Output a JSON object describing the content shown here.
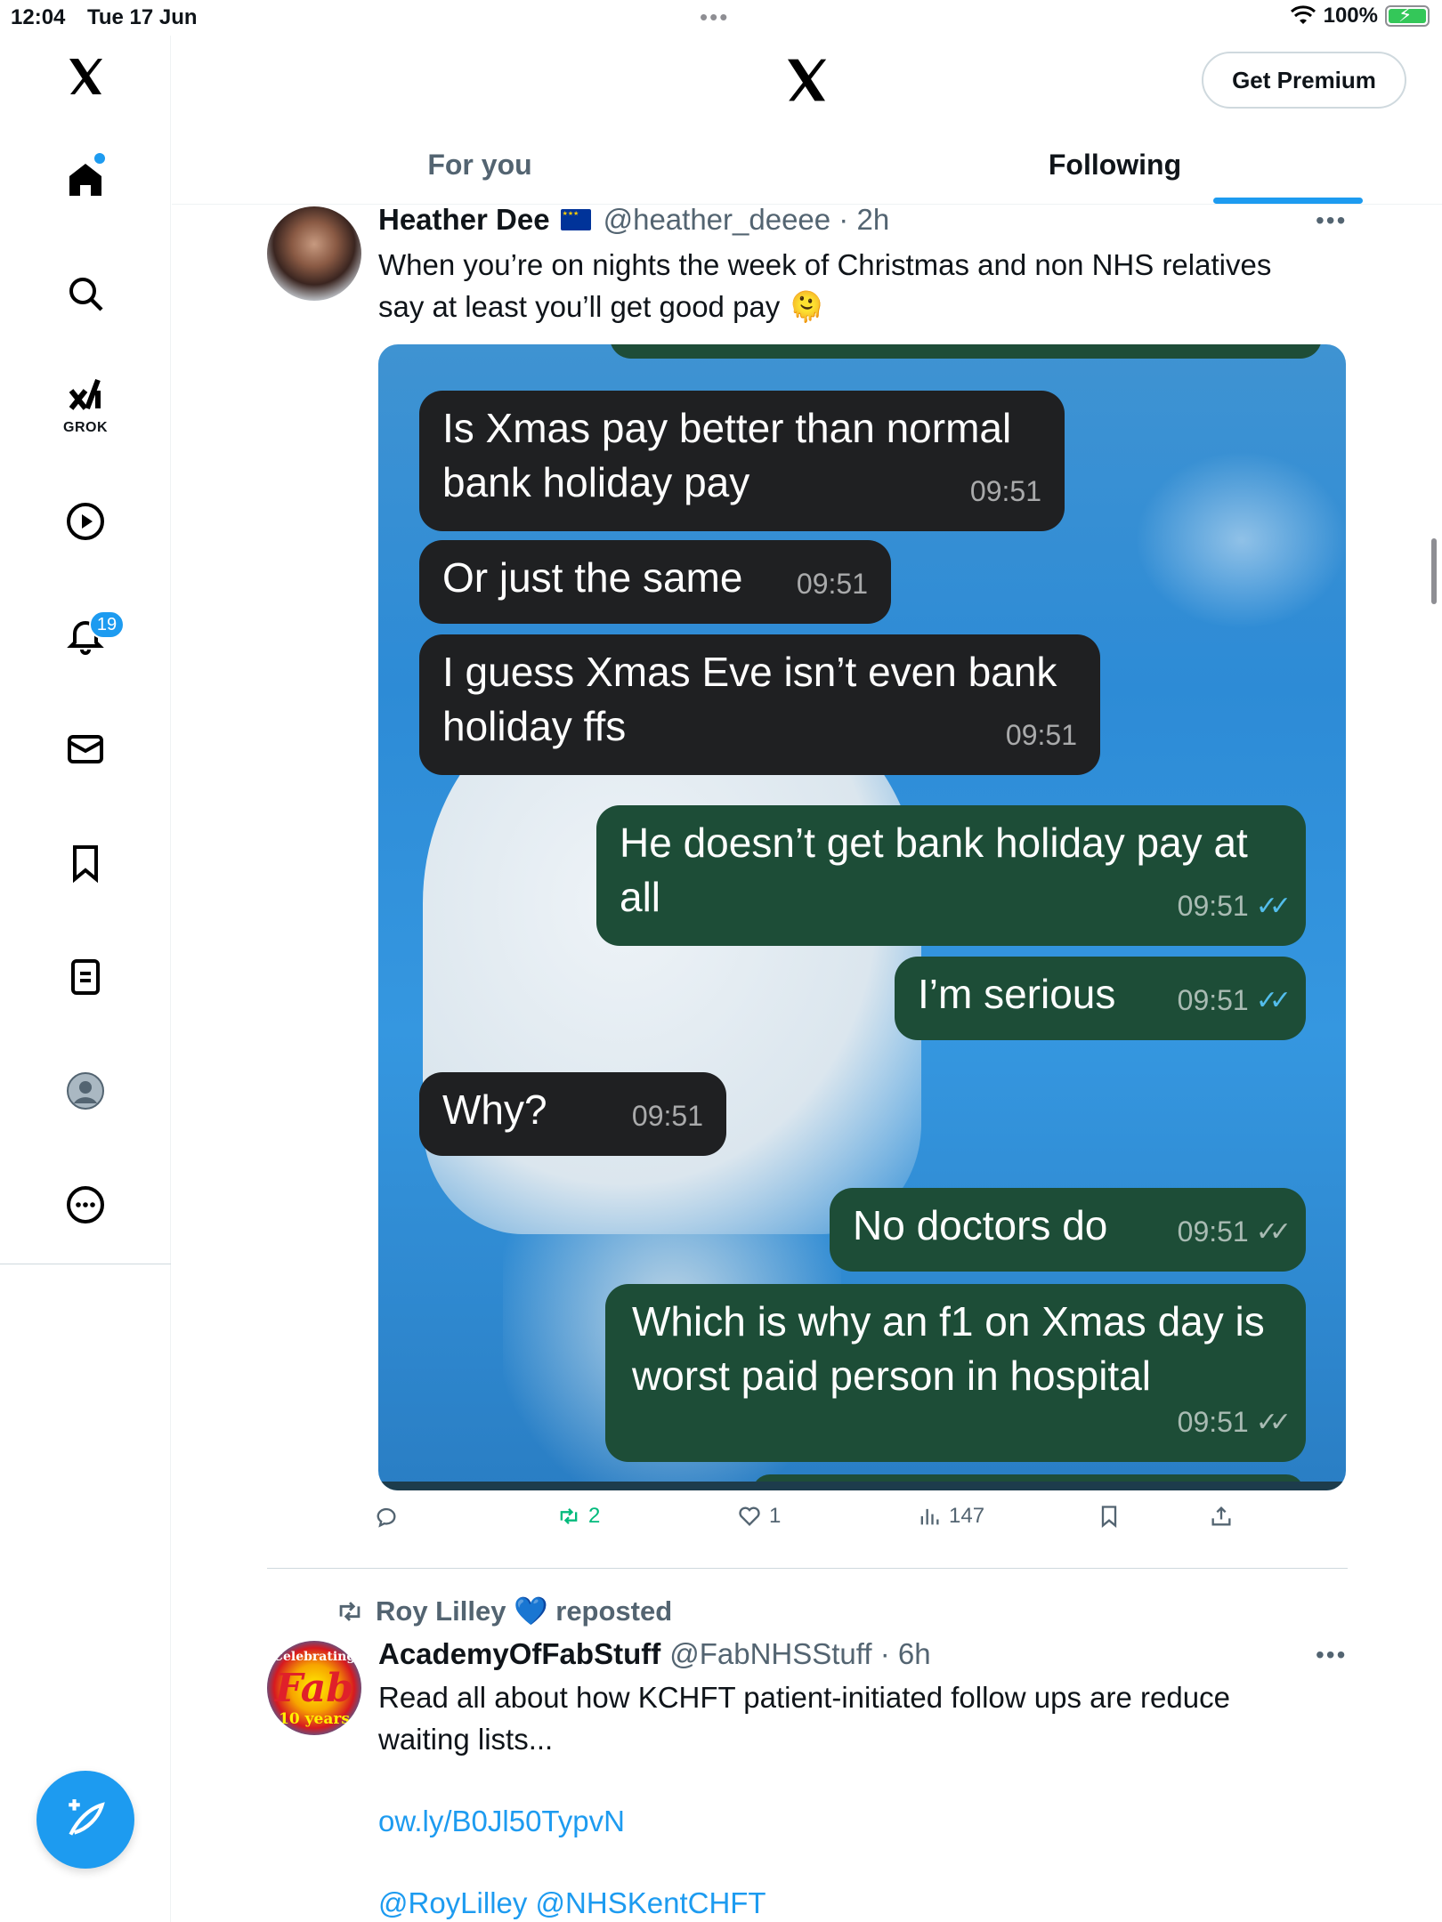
{
  "status_bar": {
    "time": "12:04",
    "date": "Tue 17 Jun",
    "battery_percent": "100%"
  },
  "nav": {
    "grok_label": "GROK",
    "notifications_count": "19"
  },
  "header": {
    "premium_label": "Get Premium"
  },
  "tabs": [
    {
      "label": "For you",
      "selected": false
    },
    {
      "label": "Following",
      "selected": true
    }
  ],
  "post1": {
    "name": "Heather Dee",
    "handle": "@heather_deeee · 2h",
    "text_line1": "When you’re on nights the week of Christmas and non NHS relatives",
    "text_line2": "say at least you’ll get good pay 🫠",
    "messages": [
      {
        "dir": "in",
        "lines": [
          "Is Xmas pay better than normal",
          "bank holiday pay"
        ],
        "time": "09:51"
      },
      {
        "dir": "in",
        "lines": [
          "Or just the same"
        ],
        "time": "09:51"
      },
      {
        "dir": "in",
        "lines": [
          "I guess Xmas Eve isn’t even bank",
          "holiday ffs"
        ],
        "time": "09:51"
      },
      {
        "dir": "out",
        "lines": [
          "He doesn’t get bank holiday pay at",
          "all"
        ],
        "time": "09:51",
        "read": true
      },
      {
        "dir": "out",
        "lines": [
          "I’m serious"
        ],
        "time": "09:51",
        "read": true
      },
      {
        "dir": "in",
        "lines": [
          "Why?"
        ],
        "time": "09:51"
      },
      {
        "dir": "out",
        "lines": [
          "No doctors do"
        ],
        "time": "09:51",
        "read": false
      },
      {
        "dir": "out",
        "lines": [
          "Which is why an f1 on Xmas day is",
          "worst paid person in hospital"
        ],
        "time": "09:51",
        "read": false
      }
    ],
    "reposts": "2",
    "likes": "1",
    "views": "147"
  },
  "post2": {
    "reposted_by": "Roy Lilley 💙 reposted",
    "name": "AcademyOfFabStuff",
    "handle": "@FabNHSStuff · 6h",
    "text_line1": "Read all about how KCHFT patient-initiated follow ups are reduce",
    "text_line2": "waiting lists...",
    "link": "ow.ly/B0Jl50TypvN",
    "mentions": "@RoyLilley @NHSKentCHFT",
    "avatar_text_top": "Celebrating",
    "avatar_text_mid": "Fab",
    "avatar_text_bot": "10 years"
  },
  "colors": {
    "accent": "#1d9bf0",
    "incoming_bubble": "#1f2022",
    "outgoing_bubble": "#1d4d37",
    "read_ticks": "#53bdeb",
    "repost_green": "#00ba7c"
  },
  "icons": [
    "x-logo",
    "home-icon",
    "search-icon",
    "grok-icon",
    "video-icon",
    "bell-icon",
    "mail-icon",
    "bookmark-icon",
    "list-icon",
    "profile-icon",
    "more-icon",
    "compose-icon",
    "reply-icon",
    "repost-icon",
    "heart-icon",
    "views-icon",
    "share-icon"
  ]
}
